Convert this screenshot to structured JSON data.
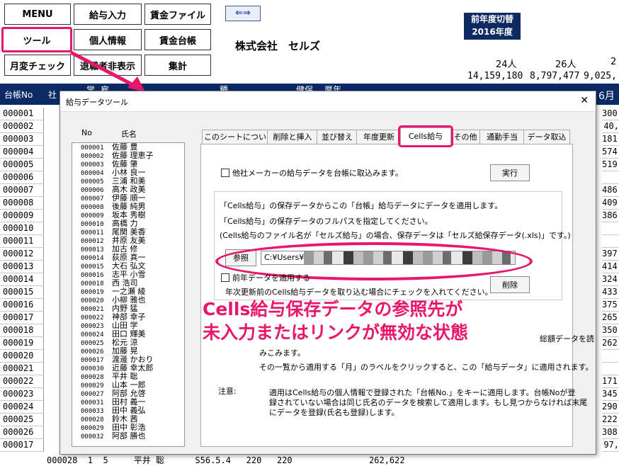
{
  "menu": {
    "row1": [
      "MENU",
      "給与入力",
      "賃金ファイル"
    ],
    "row2": [
      "ツール",
      "個人情報",
      "賃金台帳"
    ],
    "row3": [
      "月変チェック",
      "退職者非表示",
      "集計"
    ]
  },
  "nav_arrow": "⇐⇒",
  "fiscal": {
    "line1": "前年度切替",
    "line2": "2016年度"
  },
  "company": "株式会社　セルズ",
  "counts": [
    "24人",
    "26人",
    "2"
  ],
  "totals": [
    "14,159,180",
    "8,797,477",
    "9,025,"
  ],
  "grid": {
    "h_id": "台帳No",
    "h_name": "社",
    "h_3": "常",
    "h_4": "雇",
    "h_5": "種",
    "h_6": "健保",
    "h_7": "厚年",
    "h_month": "6月",
    "ids": [
      "000001",
      "000002",
      "000003",
      "000004",
      "000005",
      "000006",
      "000007",
      "000008",
      "000009",
      "000010",
      "000011",
      "000012",
      "000013",
      "000014",
      "000015",
      "000016",
      "000017",
      "000018",
      "000019",
      "000020",
      "000021",
      "000022",
      "000023",
      "000024",
      "000025",
      "000026",
      "000017"
    ],
    "right": [
      "300,",
      "40,",
      "181,",
      "574,",
      "519,",
      "",
      "486,",
      "409,",
      "386,",
      "",
      "",
      "397,",
      "414,",
      "324,",
      "433,",
      "375,",
      "265,",
      "350,",
      "262,",
      "",
      "",
      "171,",
      "345,",
      "290,",
      "222,",
      "308,",
      "97,"
    ],
    "bottom_row": "000028  1  5     平井 聡      S56.5.4   220   220               262,622"
  },
  "dialog": {
    "title": "給与データツール",
    "close": "✕",
    "list_header_no": "No",
    "list_header_name": "氏名",
    "list": [
      [
        "000001",
        "佐藤 豊"
      ],
      [
        "000002",
        "佐藤 理恵子"
      ],
      [
        "000003",
        "佐藤 肇"
      ],
      [
        "000004",
        "小林 良一"
      ],
      [
        "000005",
        "三浦 和美"
      ],
      [
        "000006",
        "高木 政美"
      ],
      [
        "000007",
        "伊藤 順一"
      ],
      [
        "000008",
        "後藤 純男"
      ],
      [
        "000009",
        "坂本 秀樹"
      ],
      [
        "000010",
        "高橋 力"
      ],
      [
        "000011",
        "尾関 美香"
      ],
      [
        "000012",
        "井原 友美"
      ],
      [
        "000013",
        "加古 修"
      ],
      [
        "000014",
        "荻原 真一"
      ],
      [
        "000015",
        "大石 弘文"
      ],
      [
        "000016",
        "志平 小雪"
      ],
      [
        "000018",
        "西 浩司"
      ],
      [
        "000019",
        "一之瀬 綾"
      ],
      [
        "000020",
        "小柳 雅也"
      ],
      [
        "000021",
        "内野 猛"
      ],
      [
        "000022",
        "神部 幸子"
      ],
      [
        "000023",
        "山田 学"
      ],
      [
        "000024",
        "田口 輝美"
      ],
      [
        "000025",
        "松元 涼"
      ],
      [
        "000026",
        "加藤 晃"
      ],
      [
        "000017",
        "渡邊 かおり"
      ],
      [
        "000030",
        "近藤 幸太郎"
      ],
      [
        "000028",
        "平井 聡"
      ],
      [
        "000029",
        "山本 一郎"
      ],
      [
        "000027",
        "阿部 允啓"
      ],
      [
        "000031",
        "田村 義一"
      ],
      [
        "000033",
        "田中 義弘"
      ],
      [
        "000028",
        "鈴木 茜"
      ],
      [
        "000029",
        "田中 彰浩"
      ],
      [
        "000032",
        "阿部 勝也"
      ]
    ],
    "tabs": [
      "このシートについて",
      "削除と挿入",
      "並び替え",
      "年度更新",
      "Cells給与",
      "その他",
      "通勤手当",
      "データ取込"
    ],
    "chk_other": "他社メーカーの給与データを台帳に取込みます。",
    "btn_run": "実行",
    "info1": "「Cells給与」の保存データからこの「台帳」給与データにデータを適用します。",
    "info2": "「Cells給与」の保存データのフルパスを指定してください。",
    "info3": "(Cells給与のファイル名が「セルズ給与」の場合、保存データは「セルズ給保存データ(.xls)」です。)",
    "btn_browse": "参照",
    "path_value": "C:¥Users¥",
    "chk_prev": "前年データを適用する",
    "note_prev": "年次更新前のCells給与データを取り込む場合にチェックを入れてください。",
    "btn_delete": "削除",
    "overlay_line1": "Cells給与保存データの参照先が",
    "overlay_line2": "未入力またはリンクが無効な状態",
    "hidden_tail": "総額データを読",
    "hidden_tail2": "みこみます。",
    "apply_text": "その一覧から適用する「月」のラベルをクリックすると、この「給与データ」に適用されます。",
    "note_label": "注意:",
    "note1": "適用はCells給与の個人情報で登録された「台帳No.」をキーに適用します。台帳Noが登",
    "note2": "録されていない場合は同じ氏名のデータを検索して適用します。もし見つからなければ末尾",
    "note3": "にデータを登録(氏名も登録)します。"
  },
  "colors": {
    "highlight": "#e8176c",
    "grid_header": "#0b2a66",
    "fiscal_box": "#0d2a63"
  }
}
